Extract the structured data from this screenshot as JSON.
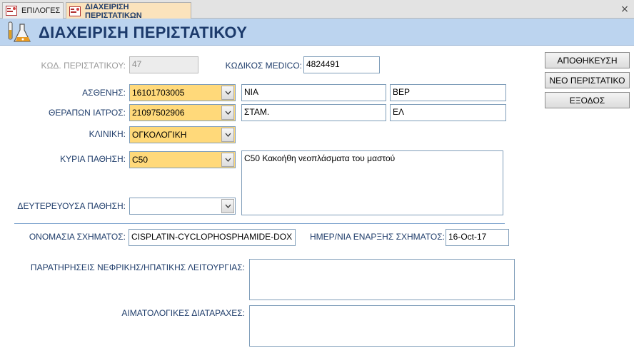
{
  "tabs": [
    {
      "label": "ΕΠΙΛΟΓΕΣ",
      "active": false,
      "icon": "form-icon"
    },
    {
      "label": "ΔΙΑΧΕΙΡΙΣΗ ΠΕΡΙΣΤΑΤΙΚΩΝ",
      "active": true,
      "icon": "form-icon"
    }
  ],
  "tab_close_glyph": "×",
  "header": {
    "title": "ΔΙΑΧΕΙΡΙΣΗ ΠΕΡΙΣΤΑΤΙΚΟΥ",
    "icon": "lab-flask-icon"
  },
  "form": {
    "case_code": {
      "label": "ΚΩΔ. ΠΕΡΙΣΤΑΤΙΚΟΥ:",
      "value": "47"
    },
    "medico_code": {
      "label": "ΚΩΔΙΚΟΣ MEDICO:",
      "value": "4824491"
    },
    "patient": {
      "label": "ΑΣΘΕΝΗΣ:",
      "value": "16101703005",
      "first_name": "ΝΙΑ",
      "last_name": "ΒΕΡ"
    },
    "doctor": {
      "label": "ΘΕΡΑΠΩΝ ΙΑΤΡΟΣ:",
      "value": "21097502906",
      "first_name": "ΣΤΑΜ.",
      "last_name": "ΕΛ"
    },
    "clinic": {
      "label": "ΚΛΙΝΙΚΗ:",
      "value": "ΟΓΚΟΛΟΓΙΚΗ"
    },
    "main_condition": {
      "label": "ΚΥΡΙΑ ΠΑΘΗΣΗ:",
      "value": "C50",
      "description": "C50 Κακοήθη νεοπλάσματα του μαστού"
    },
    "secondary_condition": {
      "label": "ΔΕΥΤΕΡΕΥΟΥΣΑ ΠΑΘΗΣΗ:",
      "value": ""
    },
    "scheme_name": {
      "label": "ΟΝΟΜΑΣΙΑ ΣΧΗΜΑΤΟΣ:",
      "value": "CISPLATIN-CYCLOPHOSPHAMIDE-DOX"
    },
    "scheme_start": {
      "label": "ΗΜΕΡ/ΝΙΑ ΕΝΑΡΞΗΣ ΣΧΗΜΑΤΟΣ:",
      "value": "16-Oct-17"
    },
    "renal_notes": {
      "label": "ΠΑΡΑΤΗΡΗΣΕΙΣ ΝΕΦΡΙΚΗΣ/ΗΠΑΤΙΚΗΣ ΛΕΙΤΟΥΡΓΙΑΣ:",
      "value": ""
    },
    "hematology": {
      "label": "ΑΙΜΑΤΟΛΟΓΙΚΕΣ ΔΙΑΤΑΡΑΧΕΣ:",
      "value": ""
    }
  },
  "buttons": {
    "save": "ΑΠΟΘΗΚΕΥΣΗ",
    "new_case": "ΝΕΟ ΠΕΡΙΣΤΑΤΙΚΟ",
    "exit": "ΕΞΟΔΟΣ"
  },
  "colors": {
    "combo_bg": "#ffd97a",
    "label": "#1f3d6b",
    "header_bg": "#bcd4ef",
    "active_tab": "#fbe3bc"
  }
}
